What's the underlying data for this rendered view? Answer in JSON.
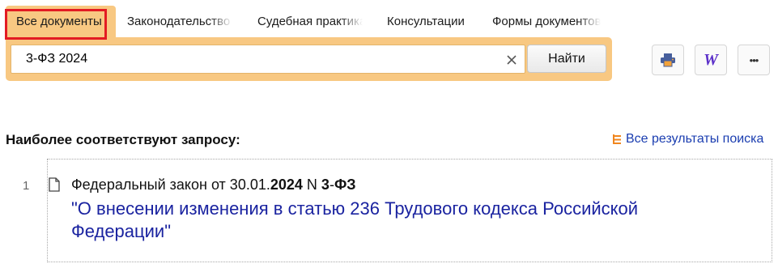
{
  "tabs": [
    {
      "label": "Все документы",
      "active": true
    },
    {
      "label": "Законодательство",
      "active": false
    },
    {
      "label": "Судебная практика",
      "active": false
    },
    {
      "label": "Консультации",
      "active": false
    },
    {
      "label": "Формы документов",
      "active": false
    }
  ],
  "search": {
    "value": "3-ФЗ 2024",
    "button_label": "Найти",
    "clear_icon": "close-icon"
  },
  "tools": [
    {
      "name": "print",
      "icon": "printer-icon"
    },
    {
      "name": "word",
      "icon": "word-icon",
      "glyph": "W"
    },
    {
      "name": "more",
      "icon": "more-icon",
      "glyph": "•••"
    }
  ],
  "results": {
    "heading": "Наиболее соответствуют запросу:",
    "all_results_label": "Все результаты поиска",
    "items": [
      {
        "number": "1",
        "title_prefix": "Федеральный закон от 30.01.",
        "title_year": "2024",
        "title_mid": " N ",
        "title_num": "3",
        "title_dash": "-",
        "title_fz": "ФЗ",
        "link": "\"О внесении изменения в статью 236 Трудового кодекса Российской Федерации\""
      }
    ]
  },
  "colors": {
    "accent": "#f8c882",
    "highlight_border": "#e31b23",
    "link": "#1a23a0",
    "all_results_link": "#1a3db0",
    "tree_icon": "#f0861e",
    "word_icon": "#5b2fc9",
    "print_icon": "#465e9c"
  }
}
